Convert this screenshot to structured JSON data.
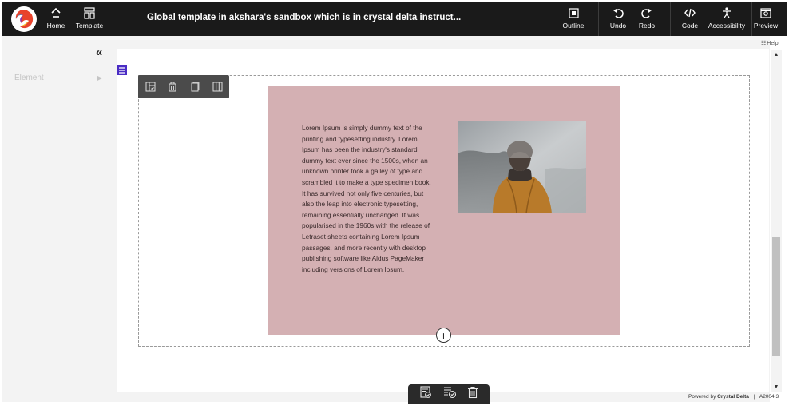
{
  "header": {
    "title": "Global template in akshara's sandbox which is in crystal delta instruct...",
    "left_nav": [
      {
        "label": "Home",
        "icon": "home-icon"
      },
      {
        "label": "Template",
        "icon": "template-icon"
      }
    ],
    "right_actions": [
      {
        "label": "Outline",
        "icon": "outline-icon"
      },
      {
        "label": "Undo",
        "icon": "undo-icon"
      },
      {
        "label": "Redo",
        "icon": "redo-icon"
      },
      {
        "label": "Code",
        "icon": "code-icon"
      },
      {
        "label": "Accessibility",
        "icon": "accessibility-icon"
      },
      {
        "label": "Preview",
        "icon": "preview-icon"
      }
    ]
  },
  "sidebar": {
    "collapse_glyph": "«",
    "items": [
      {
        "label": "Element",
        "arrow": "▶"
      }
    ]
  },
  "workspace": {
    "help_label": "Help",
    "section_toolbar_icons": [
      "layout-settings-icon",
      "delete-icon",
      "duplicate-icon",
      "columns-icon"
    ],
    "block": {
      "background": "#d4b0b3",
      "text": "Lorem Ipsum is simply dummy text of the printing and typesetting industry. Lorem Ipsum has been the industry's standard dummy text ever since the 1500s, when an unknown printer took a galley of type and scrambled it to make a type specimen book. It has survived not only five centuries, but also the leap into electronic typesetting, remaining essentially unchanged. It was popularised in the 1960s with the release of Letraset sheets containing Lorem Ipsum passages, and more recently with desktop publishing software like Aldus PageMaker including versions of Lorem Ipsum."
    },
    "add_glyph": "+",
    "bottom_toolbar_icons": [
      "save-icon",
      "publish-icon",
      "trash-icon"
    ]
  },
  "footer": {
    "powered_by": "Powered by",
    "brand": "Crystal Delta",
    "separator": "|",
    "version": "A2004.3"
  },
  "colors": {
    "topbar": "#1a1a1a",
    "accent": "#4a2cc4",
    "block": "#d4b0b3"
  }
}
